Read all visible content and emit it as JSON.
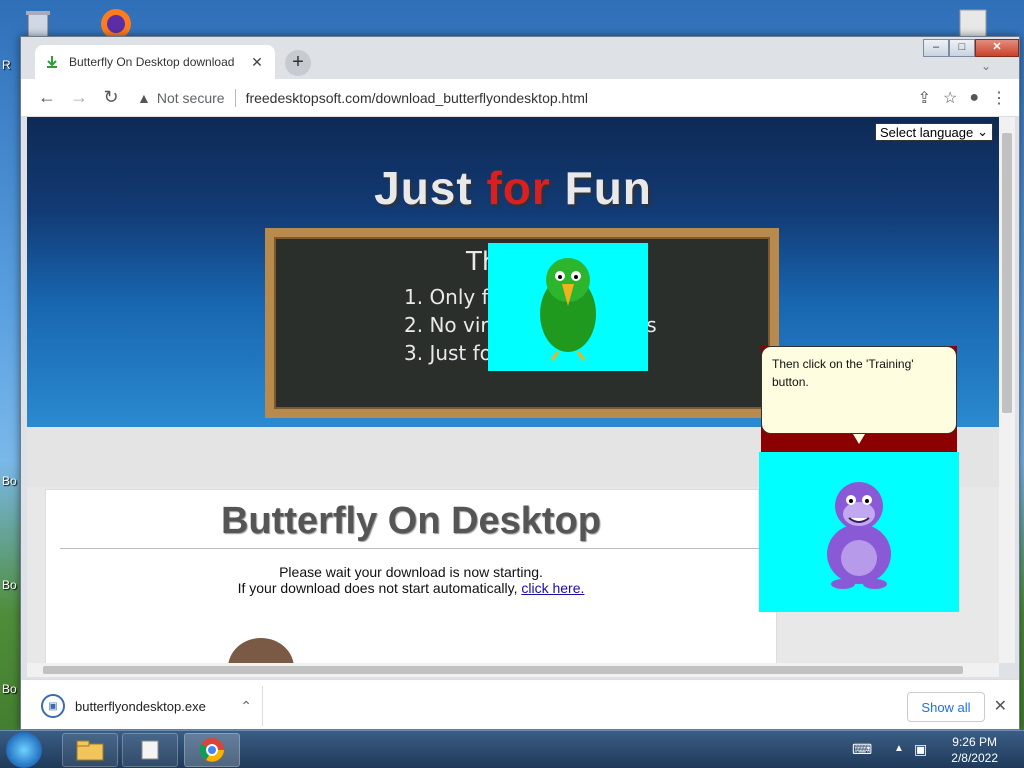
{
  "desktop": {
    "labels": [
      "R",
      "Bo",
      "Bo",
      "Bo"
    ]
  },
  "browser": {
    "tab_title": "Butterfly On Desktop download",
    "new_tab_symbol": "+",
    "security_label": "Not secure",
    "url": "freedesktopsoft.com/download_butterflyondesktop.html",
    "window_min": "–",
    "window_max": "□",
    "window_close": "✕"
  },
  "page": {
    "language_select": "Select language",
    "banner": {
      "part1": "Just ",
      "part2": "for",
      "part3": " Fun"
    },
    "chalkboard": {
      "heading": "Th",
      "lines": [
        "1. Only free",
        "2. No viruse",
        "3. Just for"
      ],
      "line2_tail": "rs"
    },
    "product_title": "Butterfly On Desktop",
    "wait_line": "Please wait your download is now starting.",
    "fallback_prefix": "If your download does not start automatically, ",
    "fallback_link": "click here.",
    "bonzi_bubble": "Then click on the 'Training' button."
  },
  "downloads": {
    "filename": "butterflyondesktop.exe",
    "show_all": "Show all"
  },
  "taskbar": {
    "time": "9:26 PM",
    "date": "2/8/2022"
  },
  "colors": {
    "accent_blue": "#1a73e8",
    "banner_red": "#d92020",
    "cyan_bg": "#00ffff",
    "chalkboard_frame": "#b88a4e"
  }
}
